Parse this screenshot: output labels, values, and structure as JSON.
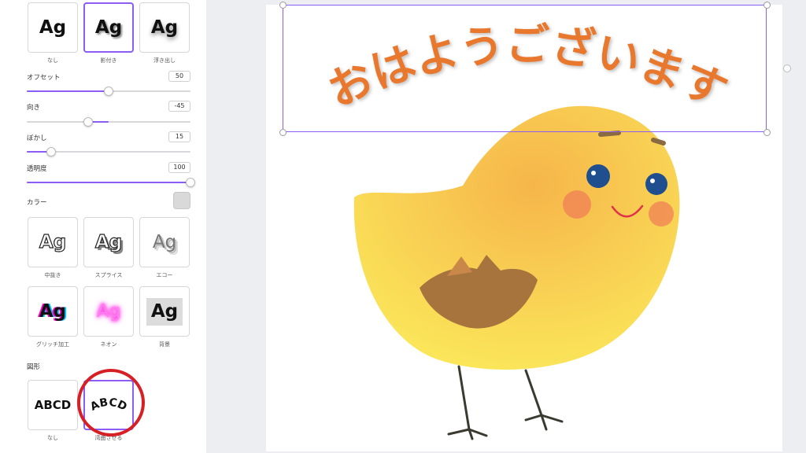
{
  "effects_top": {
    "items": [
      {
        "label": "なし",
        "glyph": "Ag",
        "style": "none"
      },
      {
        "label": "影付き",
        "glyph": "Ag",
        "style": "shadow",
        "selected": true
      },
      {
        "label": "浮き出し",
        "glyph": "Ag",
        "style": "lift"
      }
    ]
  },
  "shadow_settings": {
    "offset": {
      "label": "オフセット",
      "value": "50",
      "fraction": 0.5
    },
    "direction": {
      "label": "向き",
      "value": "-45",
      "fraction": 0.375
    },
    "blur": {
      "label": "ぼかし",
      "value": "15",
      "fraction": 0.15
    },
    "transparency": {
      "label": "透明度",
      "value": "100",
      "fraction": 1.0
    },
    "color_label": "カラー",
    "color": "#d9d9d9"
  },
  "effects_more": {
    "items": [
      {
        "label": "中抜き",
        "glyph": "Ag",
        "style": "hollow"
      },
      {
        "label": "スプライス",
        "glyph": "Ag",
        "style": "splice"
      },
      {
        "label": "エコー",
        "glyph": "Ag",
        "style": "echo"
      },
      {
        "label": "グリッチ加工",
        "glyph": "Ag",
        "style": "glitch"
      },
      {
        "label": "ネオン",
        "glyph": "Ag",
        "style": "neon"
      },
      {
        "label": "背景",
        "glyph": "Ag",
        "style": "bg"
      }
    ]
  },
  "shape": {
    "title": "図形",
    "items": [
      {
        "label": "なし",
        "text": "ABCD"
      },
      {
        "label": "湾曲させる",
        "text": "ABCD",
        "selected": true
      }
    ]
  },
  "canvas": {
    "headline": "おはようございます",
    "headline_color": "#e8782f"
  },
  "colors": {
    "accent": "#8b5cf6",
    "annotation": "#d72025"
  }
}
